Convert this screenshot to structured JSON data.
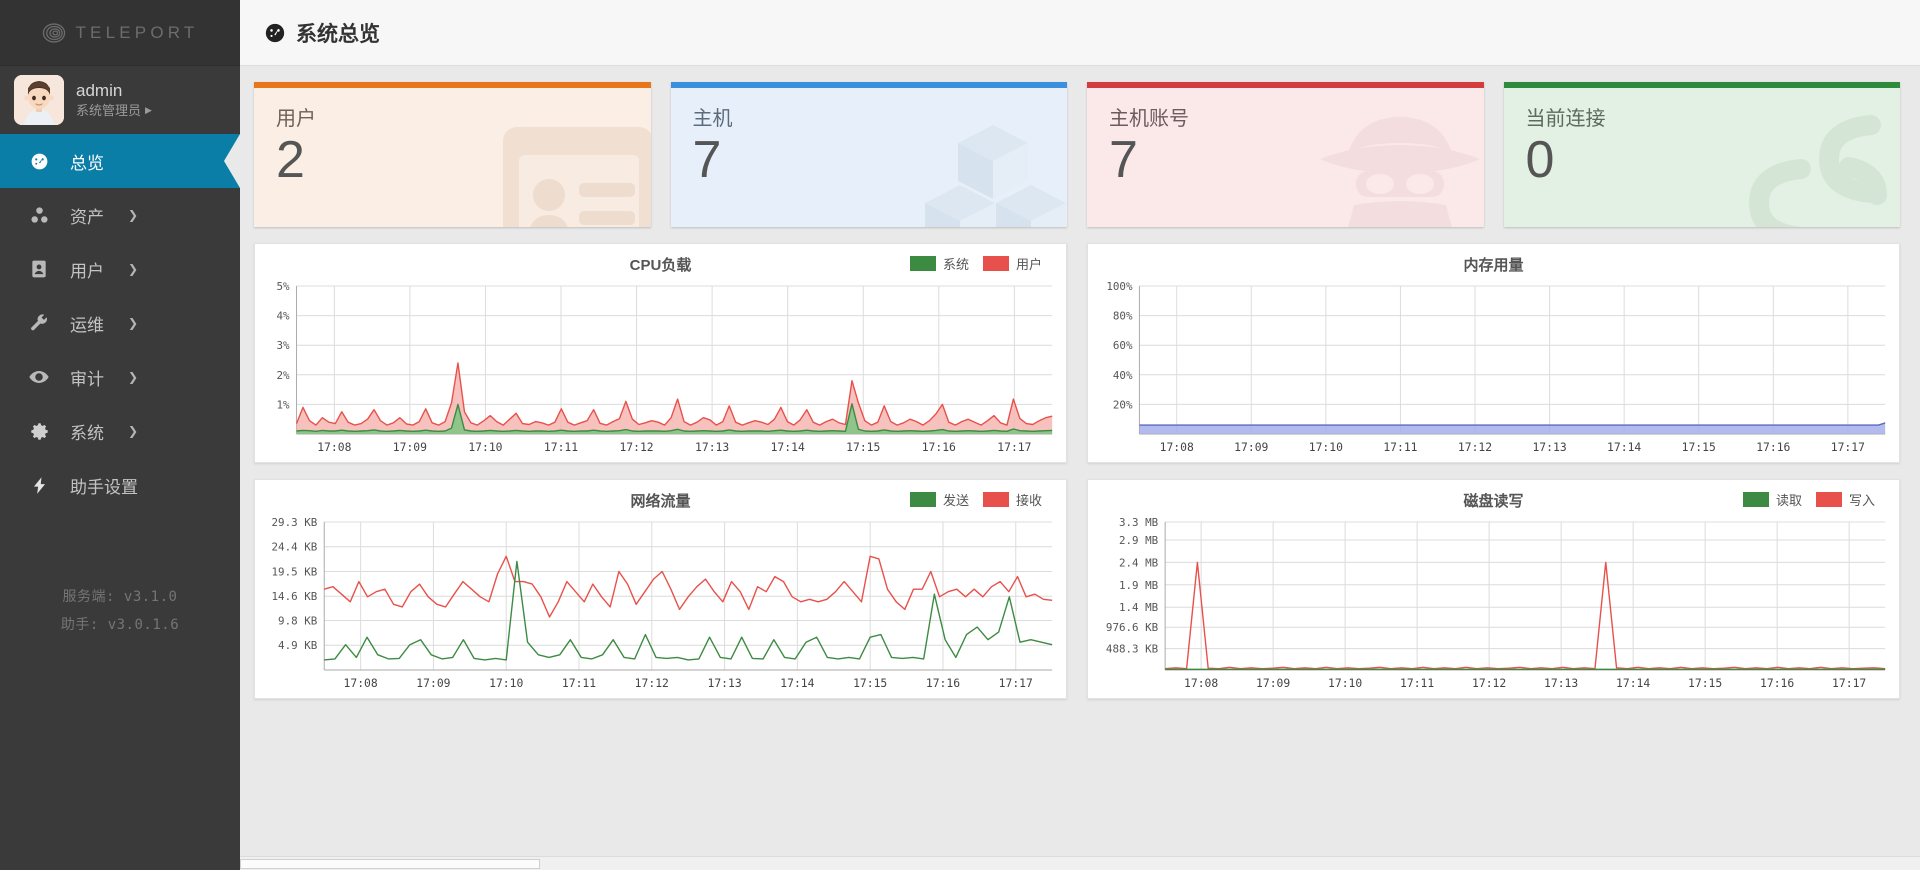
{
  "brand": {
    "name": "TELEPORT",
    "logo_icon": "spiral-icon"
  },
  "user": {
    "name": "admin",
    "role": "系统管理员",
    "caret": "▶",
    "avatar_icon": "user-avatar"
  },
  "sidebar": {
    "items": [
      {
        "label": "总览",
        "icon": "dashboard-icon",
        "active": true,
        "chevron": ""
      },
      {
        "label": "资产",
        "icon": "assets-icon",
        "active": false,
        "chevron": "❯"
      },
      {
        "label": "用户",
        "icon": "user-card-icon",
        "active": false,
        "chevron": "❯"
      },
      {
        "label": "运维",
        "icon": "wrench-icon",
        "active": false,
        "chevron": "❯"
      },
      {
        "label": "审计",
        "icon": "eye-icon",
        "active": false,
        "chevron": "❯"
      },
      {
        "label": "系统",
        "icon": "gear-icon",
        "active": false,
        "chevron": "❯"
      },
      {
        "label": "助手设置",
        "icon": "bolt-icon",
        "active": false,
        "chevron": ""
      }
    ],
    "versions": [
      "服务端: v3.1.0",
      "助手: v3.0.1.6"
    ]
  },
  "header": {
    "title": "系统总览",
    "icon": "gauge-icon"
  },
  "cards": [
    {
      "label": "用户",
      "value": "2",
      "accent": "#e8761a",
      "bg": "#fbeee4",
      "label_color": "#6d6257",
      "icon": "id-card-icon"
    },
    {
      "label": "主机",
      "value": "7",
      "accent": "#3b90dd",
      "bg": "#e7f0fa",
      "label_color": "#5b6b7c",
      "icon": "cubes-icon"
    },
    {
      "label": "主机账号",
      "value": "7",
      "accent": "#d43d3d",
      "bg": "#fbe9ea",
      "label_color": "#6d5a5c",
      "icon": "spy-icon"
    },
    {
      "label": "当前连接",
      "value": "0",
      "accent": "#2e8b3d",
      "bg": "#e3f0e4",
      "label_color": "#5b6b5c",
      "icon": "chain-icon"
    }
  ],
  "chart_data": [
    {
      "id": "cpu",
      "type": "area",
      "title": "CPU负载",
      "xlabel": "",
      "ylabel": "",
      "ylim": [
        0,
        5
      ],
      "ytick_labels": [
        "1%",
        "2%",
        "3%",
        "4%",
        "5%"
      ],
      "ytick_values": [
        1,
        2,
        3,
        4,
        5
      ],
      "xtick_labels": [
        "17:08",
        "17:09",
        "17:10",
        "17:11",
        "17:12",
        "17:13",
        "17:14",
        "17:15",
        "17:16",
        "17:17"
      ],
      "grid": true,
      "legend_position": "top-right",
      "legend": [
        {
          "name": "系统",
          "color": "#3d8b43"
        },
        {
          "name": "用户",
          "color": "#e8514b"
        }
      ],
      "series": [
        {
          "name": "用户",
          "color": "#e8514b",
          "fill": "#f6b6b3",
          "values": [
            0.35,
            0.9,
            0.45,
            0.3,
            0.55,
            0.4,
            0.35,
            0.75,
            0.4,
            0.3,
            0.35,
            0.5,
            0.82,
            0.45,
            0.3,
            0.38,
            0.55,
            0.34,
            0.3,
            0.42,
            0.85,
            0.38,
            0.3,
            0.42,
            1.05,
            2.4,
            0.75,
            0.38,
            0.3,
            0.45,
            0.62,
            0.42,
            0.3,
            0.5,
            0.7,
            0.35,
            0.32,
            0.42,
            0.38,
            0.3,
            0.4,
            0.85,
            0.4,
            0.3,
            0.38,
            0.45,
            0.82,
            0.36,
            0.3,
            0.42,
            0.52,
            1.1,
            0.5,
            0.32,
            0.38,
            0.45,
            0.4,
            0.3,
            0.55,
            1.18,
            0.42,
            0.3,
            0.4,
            0.55,
            0.48,
            0.3,
            0.42,
            0.95,
            0.4,
            0.3,
            0.38,
            0.45,
            0.4,
            0.32,
            0.5,
            0.9,
            0.42,
            0.3,
            0.48,
            0.82,
            0.4,
            0.3,
            0.42,
            0.5,
            0.38,
            0.32,
            1.8,
            1.05,
            0.45,
            0.3,
            0.4,
            0.95,
            0.42,
            0.3,
            0.38,
            0.5,
            0.42,
            0.3,
            0.45,
            0.68,
            1.0,
            0.4,
            0.3,
            0.42,
            0.5,
            0.4,
            0.3,
            0.45,
            0.62,
            0.38,
            0.3,
            1.18,
            0.52,
            0.35,
            0.32,
            0.45,
            0.55,
            0.6
          ]
        },
        {
          "name": "系统",
          "color": "#3d8b43",
          "fill": "#7dc482",
          "values": [
            0.1,
            0.12,
            0.11,
            0.09,
            0.12,
            0.1,
            0.1,
            0.13,
            0.1,
            0.09,
            0.1,
            0.11,
            0.14,
            0.1,
            0.09,
            0.1,
            0.12,
            0.1,
            0.09,
            0.1,
            0.13,
            0.1,
            0.09,
            0.1,
            0.2,
            1.0,
            0.14,
            0.1,
            0.09,
            0.1,
            0.12,
            0.1,
            0.09,
            0.1,
            0.12,
            0.1,
            0.09,
            0.1,
            0.1,
            0.09,
            0.1,
            0.13,
            0.1,
            0.09,
            0.1,
            0.1,
            0.13,
            0.1,
            0.09,
            0.1,
            0.11,
            0.15,
            0.1,
            0.09,
            0.1,
            0.1,
            0.1,
            0.09,
            0.11,
            0.16,
            0.1,
            0.09,
            0.1,
            0.11,
            0.1,
            0.09,
            0.1,
            0.14,
            0.1,
            0.09,
            0.1,
            0.1,
            0.1,
            0.09,
            0.11,
            0.13,
            0.1,
            0.09,
            0.1,
            0.13,
            0.1,
            0.09,
            0.1,
            0.11,
            0.1,
            0.09,
            1.02,
            0.16,
            0.1,
            0.09,
            0.1,
            0.14,
            0.1,
            0.09,
            0.1,
            0.11,
            0.1,
            0.09,
            0.1,
            0.12,
            0.15,
            0.1,
            0.09,
            0.1,
            0.11,
            0.1,
            0.09,
            0.1,
            0.12,
            0.1,
            0.09,
            0.17,
            0.11,
            0.1,
            0.09,
            0.1,
            0.11,
            0.12
          ]
        }
      ]
    },
    {
      "id": "memory",
      "type": "area",
      "title": "内存用量",
      "xlabel": "",
      "ylabel": "",
      "ylim": [
        0,
        100
      ],
      "ytick_labels": [
        "20%",
        "40%",
        "60%",
        "80%",
        "100%"
      ],
      "ytick_values": [
        20,
        40,
        60,
        80,
        100
      ],
      "xtick_labels": [
        "17:08",
        "17:09",
        "17:10",
        "17:11",
        "17:12",
        "17:13",
        "17:14",
        "17:15",
        "17:16",
        "17:17"
      ],
      "grid": true,
      "legend_position": "none",
      "legend": [],
      "series": [
        {
          "name": "内存",
          "color": "#5c6bc0",
          "fill": "#a6aeea",
          "values": [
            6,
            6,
            6,
            6,
            6,
            6,
            6,
            6,
            6,
            6,
            6,
            6,
            6,
            6,
            6,
            6,
            6,
            6,
            6,
            6,
            6,
            6,
            6,
            6,
            6,
            6,
            6,
            6,
            6,
            6,
            6,
            6,
            6,
            6,
            6,
            6,
            6,
            6,
            6,
            6,
            6,
            6,
            6,
            6,
            6,
            6,
            6,
            6,
            6,
            6,
            6,
            6,
            6,
            6,
            6,
            6,
            6,
            6,
            6,
            6,
            6,
            6,
            6,
            6,
            6,
            6,
            6,
            6,
            6,
            6,
            6,
            6,
            6,
            6,
            6,
            6,
            6,
            6,
            6,
            6,
            6,
            6,
            6,
            6,
            6,
            6,
            6,
            6,
            6,
            6,
            6,
            6,
            6,
            6,
            6,
            6,
            6,
            6,
            6,
            6,
            6,
            6,
            6,
            6,
            6,
            6,
            6,
            6,
            6,
            6,
            6,
            6,
            6,
            7.5
          ]
        }
      ]
    },
    {
      "id": "network",
      "type": "line",
      "title": "网络流量",
      "xlabel": "",
      "ylabel": "",
      "ylim": [
        0,
        29.3
      ],
      "ytick_labels": [
        "4.9 KB",
        "9.8 KB",
        "14.6 KB",
        "19.5 KB",
        "24.4 KB",
        "29.3 KB"
      ],
      "ytick_values": [
        4.9,
        9.8,
        14.6,
        19.5,
        24.4,
        29.3
      ],
      "xtick_labels": [
        "17:08",
        "17:09",
        "17:10",
        "17:11",
        "17:12",
        "17:13",
        "17:14",
        "17:15",
        "17:16",
        "17:17"
      ],
      "grid": true,
      "legend_position": "top-right",
      "legend": [
        {
          "name": "发送",
          "color": "#3d8b43"
        },
        {
          "name": "接收",
          "color": "#e8514b"
        }
      ],
      "series": [
        {
          "name": "接收",
          "color": "#e8514b",
          "values": [
            16,
            16.5,
            15,
            13.5,
            17.5,
            14.5,
            15.5,
            16,
            13,
            12.5,
            15.5,
            17,
            14.5,
            13,
            12.5,
            15,
            17.5,
            16,
            14.5,
            13.5,
            19,
            22.5,
            17.5,
            17.5,
            17,
            14.5,
            10.5,
            13.5,
            17.5,
            15.5,
            13.5,
            17,
            14.5,
            12.5,
            19.5,
            17,
            13,
            15.5,
            18,
            19.5,
            16,
            12,
            14.5,
            16.5,
            18,
            15.5,
            13.5,
            17.5,
            15.5,
            12,
            16.5,
            15.5,
            18.5,
            17.5,
            14.5,
            13.5,
            14,
            13.5,
            14,
            15.5,
            17.5,
            15.5,
            13.5,
            22.5,
            22,
            16,
            13.5,
            12,
            16,
            16,
            19.5,
            14.5,
            15.5,
            16,
            14.5,
            16,
            14.5,
            16.5,
            17.5,
            15.5,
            18.5,
            14.5,
            15,
            14,
            13.8
          ]
        },
        {
          "name": "发送",
          "color": "#3d8b43",
          "values": [
            2,
            2.2,
            5,
            2.5,
            6.5,
            3,
            2.2,
            2.3,
            5,
            6,
            3,
            2.2,
            2.5,
            6,
            2.3,
            2,
            2.3,
            2,
            21.5,
            5.5,
            3,
            2.5,
            3,
            6,
            2.5,
            2.2,
            3,
            6,
            2.5,
            2.2,
            7,
            2.5,
            2.3,
            2.5,
            2,
            2.2,
            6.5,
            2.5,
            2.2,
            6.5,
            2.3,
            2.2,
            6,
            2.5,
            2.2,
            5.5,
            6.5,
            2.5,
            2.2,
            2.5,
            2.2,
            6.5,
            7,
            2.5,
            2.3,
            2.5,
            2.2,
            15,
            6,
            2.5,
            7,
            8.5,
            6,
            7.5,
            14.5,
            5.5,
            6,
            5.5,
            5
          ]
        }
      ]
    },
    {
      "id": "disk",
      "type": "line",
      "title": "磁盘读写",
      "xlabel": "",
      "ylabel": "",
      "ylim": [
        0,
        3.3
      ],
      "ytick_labels": [
        "488.3 KB",
        "976.6 KB",
        "1.4 MB",
        "1.9 MB",
        "2.4 MB",
        "2.9 MB",
        "3.3 MB"
      ],
      "ytick_values": [
        0.477,
        0.954,
        1.4,
        1.9,
        2.4,
        2.9,
        3.3
      ],
      "xtick_labels": [
        "17:08",
        "17:09",
        "17:10",
        "17:11",
        "17:12",
        "17:13",
        "17:14",
        "17:15",
        "17:16",
        "17:17"
      ],
      "grid": true,
      "legend_position": "top-right",
      "legend": [
        {
          "name": "读取",
          "color": "#3d8b43"
        },
        {
          "name": "写入",
          "color": "#e8514b"
        }
      ],
      "series": [
        {
          "name": "写入",
          "color": "#e8514b",
          "values": [
            0.03,
            0.05,
            0.03,
            2.4,
            0.04,
            0.03,
            0.06,
            0.03,
            0.05,
            0.03,
            0.04,
            0.06,
            0.03,
            0.05,
            0.03,
            0.06,
            0.03,
            0.05,
            0.03,
            0.04,
            0.06,
            0.03,
            0.05,
            0.03,
            0.06,
            0.03,
            0.05,
            0.03,
            0.06,
            0.03,
            0.05,
            0.03,
            0.04,
            0.06,
            0.03,
            0.05,
            0.03,
            0.06,
            0.03,
            0.05,
            0.03,
            2.4,
            0.05,
            0.03,
            0.06,
            0.03,
            0.05,
            0.03,
            0.06,
            0.03,
            0.05,
            0.03,
            0.04,
            0.06,
            0.03,
            0.05,
            0.03,
            0.06,
            0.03,
            0.05,
            0.03,
            0.06,
            0.03,
            0.05,
            0.03,
            0.04,
            0.05,
            0.03
          ]
        },
        {
          "name": "读取",
          "color": "#3d8b43",
          "values": [
            0.015,
            0.015,
            0.015,
            0.015,
            0.015,
            0.015,
            0.015,
            0.015,
            0.015,
            0.015,
            0.015,
            0.015,
            0.015,
            0.015,
            0.015,
            0.015,
            0.015,
            0.015,
            0.015,
            0.015,
            0.015,
            0.015,
            0.015,
            0.015,
            0.015,
            0.015,
            0.015,
            0.015,
            0.015,
            0.015,
            0.015,
            0.015,
            0.015,
            0.015,
            0.015,
            0.015,
            0.015,
            0.015,
            0.015,
            0.015,
            0.015,
            0.015,
            0.015,
            0.015,
            0.015,
            0.015,
            0.015,
            0.015,
            0.015,
            0.015,
            0.015,
            0.015,
            0.015,
            0.015,
            0.015,
            0.015,
            0.015,
            0.015,
            0.015,
            0.015,
            0.015,
            0.015,
            0.015,
            0.015,
            0.015,
            0.015,
            0.015,
            0.015
          ]
        }
      ]
    }
  ]
}
